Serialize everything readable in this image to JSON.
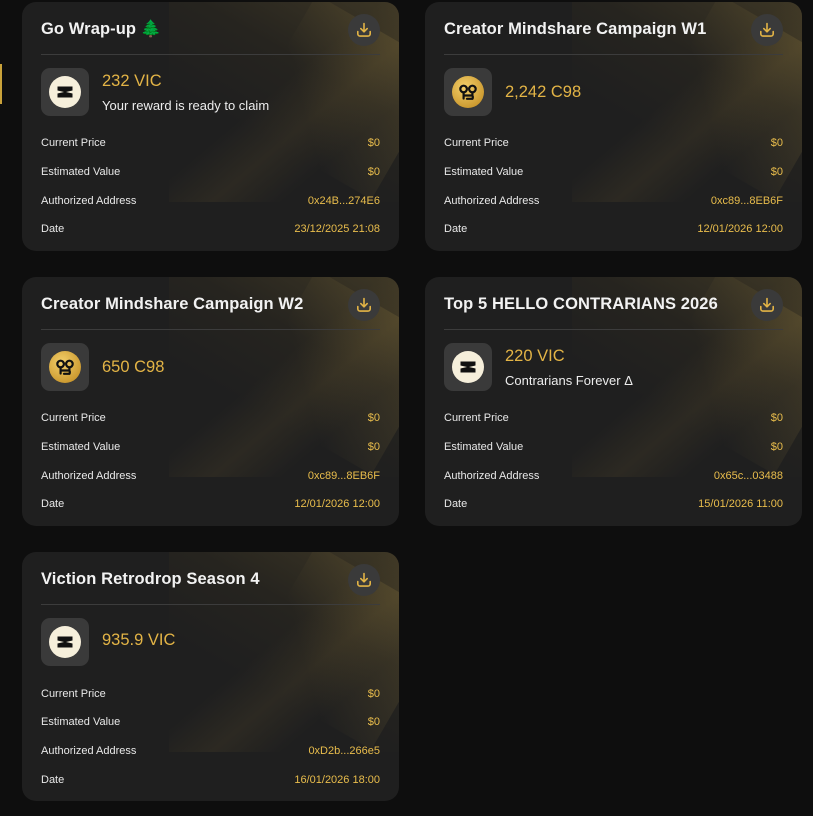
{
  "colors": {
    "accent": "#e3b446",
    "card": "#1f1f1f",
    "background": "#0e0e0e"
  },
  "labels": {
    "current_price": "Current Price",
    "estimated_value": "Estimated Value",
    "authorized_address": "Authorized Address",
    "date": "Date"
  },
  "cards": [
    {
      "title": "Go Wrap-up 🌲",
      "token_icon": "viction-logo-icon",
      "amount": "232 VIC",
      "subtitle": "Your reward is ready to claim",
      "current_price": "$0",
      "estimated_value": "$0",
      "authorized_address": "0x24B...274E6",
      "date": "23/12/2025 21:08"
    },
    {
      "title": "Creator Mindshare Campaign W1",
      "token_icon": "c98-logo-icon",
      "amount": "2,242 C98",
      "subtitle": "",
      "current_price": "$0",
      "estimated_value": "$0",
      "authorized_address": "0xc89...8EB6F",
      "date": "12/01/2026 12:00"
    },
    {
      "title": "Creator Mindshare Campaign W2",
      "token_icon": "c98-logo-icon",
      "amount": "650 C98",
      "subtitle": "",
      "current_price": "$0",
      "estimated_value": "$0",
      "authorized_address": "0xc89...8EB6F",
      "date": "12/01/2026 12:00"
    },
    {
      "title": "Top 5 HELLO CONTRARIANS 2026",
      "token_icon": "viction-logo-icon",
      "amount": "220 VIC",
      "subtitle": "Contrarians Forever Δ",
      "current_price": "$0",
      "estimated_value": "$0",
      "authorized_address": "0x65c...03488",
      "date": "15/01/2026 11:00"
    },
    {
      "title": "Viction Retrodrop Season 4",
      "token_icon": "viction-logo-icon",
      "amount": "935.9 VIC",
      "subtitle": "",
      "current_price": "$0",
      "estimated_value": "$0",
      "authorized_address": "0xD2b...266e5",
      "date": "16/01/2026 18:00"
    }
  ]
}
